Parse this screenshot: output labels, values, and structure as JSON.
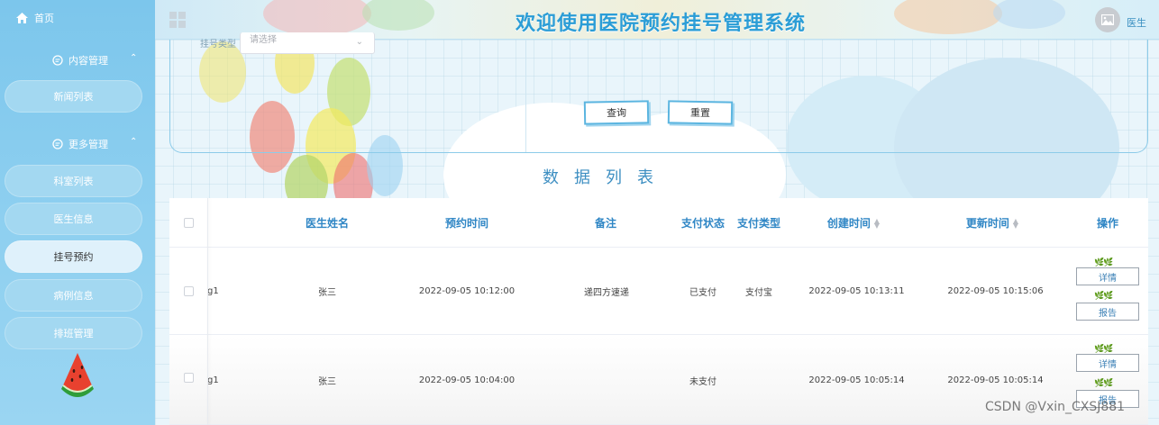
{
  "sidebar": {
    "home_label": "首页",
    "groups": [
      {
        "label": "内容管理",
        "items": [
          {
            "label": "新闻列表"
          }
        ]
      },
      {
        "label": "更多管理",
        "items": [
          {
            "label": "科室列表"
          },
          {
            "label": "医生信息"
          },
          {
            "label": "挂号预约"
          },
          {
            "label": "病例信息"
          },
          {
            "label": "排班管理"
          }
        ]
      }
    ]
  },
  "header": {
    "title": "欢迎使用医院预约挂号管理系统",
    "user": "医生"
  },
  "search": {
    "label": "挂号类型",
    "select_placeholder": "请选择",
    "query_button": "查询",
    "reset_button": "重置"
  },
  "table": {
    "title": "数据列表",
    "columns": [
      "医生姓名",
      "预约时间",
      "备注",
      "支付状态",
      "支付类型",
      "创建时间",
      "更新时间",
      "操作"
    ],
    "rows": [
      {
        "account": "g1",
        "doctor": "张三",
        "appoint_time": "2022-09-05 10:12:00",
        "remark": "递四方速递",
        "pay_status": "已支付",
        "pay_type": "支付宝",
        "created": "2022-09-05 10:13:11",
        "updated": "2022-09-05 10:15:06"
      },
      {
        "account": "g1",
        "doctor": "张三",
        "appoint_time": "2022-09-05 10:04:00",
        "remark": "",
        "pay_status": "未支付",
        "pay_type": "",
        "created": "2022-09-05 10:05:14",
        "updated": "2022-09-05 10:05:14"
      }
    ],
    "actions": {
      "detail": "详情",
      "report": "报告"
    }
  },
  "watermark": "CSDN @Vxin_CXSJ881",
  "colors": {
    "accent": "#2b9dd6",
    "sidebar": "#8fd0f0",
    "header_title": "#2b9dd6"
  }
}
